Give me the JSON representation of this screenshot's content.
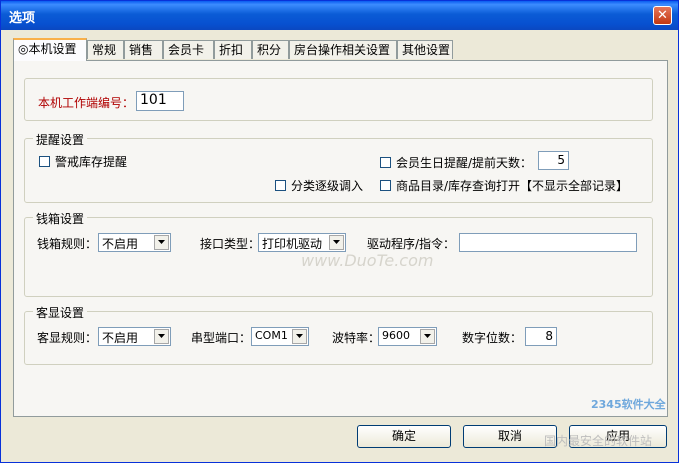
{
  "window": {
    "title": "选项",
    "close_label": "✕"
  },
  "tabs": [
    {
      "label": "◎本机设置"
    },
    {
      "label": "常规"
    },
    {
      "label": "销售"
    },
    {
      "label": "会员卡"
    },
    {
      "label": "折扣"
    },
    {
      "label": "积分"
    },
    {
      "label": "房台操作相关设置"
    },
    {
      "label": "其他设置"
    }
  ],
  "terminal": {
    "label": "本机工作端编号：",
    "value": "101"
  },
  "reminder": {
    "title": "提醒设置",
    "stock_alert": "警戒库存提醒",
    "member_birthday": "会员生日提醒/提前天数：",
    "birthday_days": "5",
    "category_load": "分类逐级调入",
    "catalog_open": "商品目录/库存查询打开【不显示全部记录】"
  },
  "cashbox": {
    "title": "钱箱设置",
    "rule_label": "钱箱规则：",
    "rule_value": "不启用",
    "port_type_label": "接口类型：",
    "port_type_value": "打印机驱动",
    "driver_label": "驱动程序/指令：",
    "driver_value": ""
  },
  "display": {
    "title": "客显设置",
    "rule_label": "客显规则：",
    "rule_value": "不启用",
    "serial_label": "串型端口：",
    "serial_value": "COM1",
    "baud_label": "波特率：",
    "baud_value": "9600",
    "digits_label": "数字位数：",
    "digits_value": "8"
  },
  "buttons": {
    "ok": "确定",
    "cancel": "取消",
    "apply": "应用"
  },
  "watermark": {
    "site": "www.DuoTe.com",
    "brand": "2345软件大全",
    "slogan": "国内最安全的软件站"
  }
}
